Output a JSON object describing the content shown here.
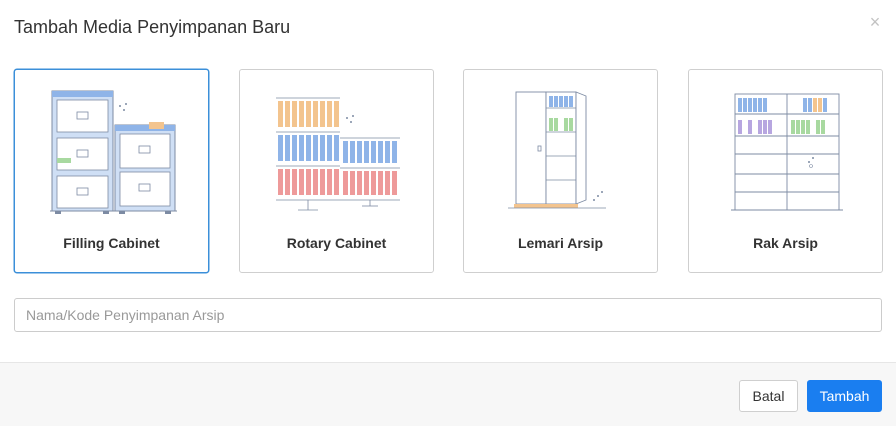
{
  "modal": {
    "title": "Tambah Media Penyimpanan Baru",
    "close_icon": "close-icon",
    "close_symbol": "×"
  },
  "options": [
    {
      "label": "Filling Cabinet",
      "icon": "filing-cabinet-icon",
      "selected": true
    },
    {
      "label": "Rotary Cabinet",
      "icon": "rotary-cabinet-icon",
      "selected": false
    },
    {
      "label": "Lemari Arsip",
      "icon": "archive-cupboard-icon",
      "selected": false
    },
    {
      "label": "Rak Arsip",
      "icon": "archive-shelf-icon",
      "selected": false
    }
  ],
  "storage_name": {
    "placeholder": "Nama/Kode Penyimpanan Arsip",
    "value": ""
  },
  "footer": {
    "cancel_label": "Batal",
    "submit_label": "Tambah"
  },
  "colors": {
    "accent": "#1a7ef0",
    "selected_border": "#3b8fd9",
    "illustration_blue": "#8fb4e8",
    "illustration_orange": "#f3c48e",
    "illustration_red": "#ee9a9a",
    "illustration_green": "#a8d9a0",
    "illustration_purple": "#b7a6e0"
  }
}
